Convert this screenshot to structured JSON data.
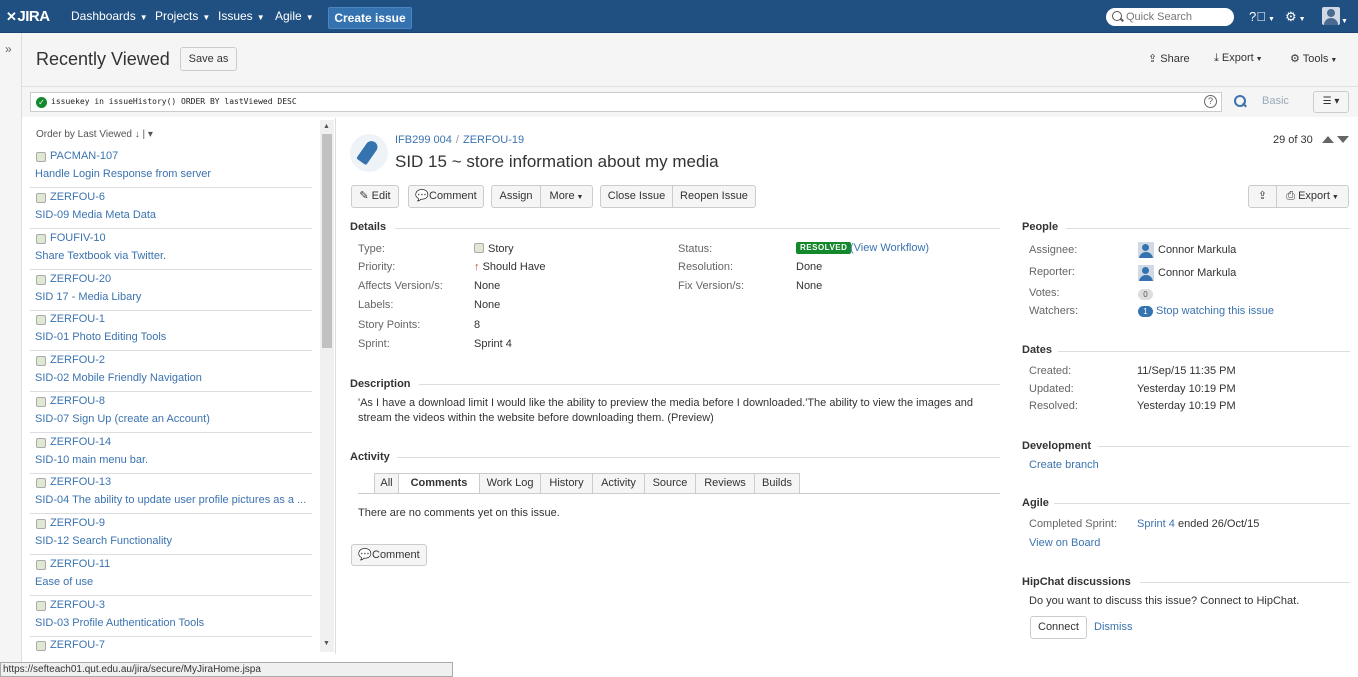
{
  "topbar": {
    "logo": "JIRA",
    "nav": [
      "Dashboards",
      "Projects",
      "Issues",
      "Agile"
    ],
    "create": "Create issue",
    "quick_search_placeholder": "Quick Search"
  },
  "header": {
    "title": "Recently Viewed",
    "save_as": "Save as",
    "share": "Share",
    "export": "Export",
    "tools": "Tools"
  },
  "search": {
    "jql": "issuekey in issueHistory() ORDER BY lastViewed DESC",
    "basic": "Basic"
  },
  "list": {
    "order_by": "Order by Last Viewed",
    "items": [
      {
        "key": "PACMAN-107",
        "summary": "Handle Login Response from server"
      },
      {
        "key": "ZERFOU-6",
        "summary": "SID-09 Media Meta Data"
      },
      {
        "key": "FOUFIV-10",
        "summary": "Share Textbook via Twitter."
      },
      {
        "key": "ZERFOU-20",
        "summary": "SID 17 - Media Libary"
      },
      {
        "key": "ZERFOU-1",
        "summary": "SID-01 Photo Editing Tools"
      },
      {
        "key": "ZERFOU-2",
        "summary": "SID-02 Mobile Friendly Navigation"
      },
      {
        "key": "ZERFOU-8",
        "summary": "SID-07 Sign Up (create an Account)"
      },
      {
        "key": "ZERFOU-14",
        "summary": "SID-10 main menu bar."
      },
      {
        "key": "ZERFOU-13",
        "summary": "SID-04 The ability to update user profile pictures as a ..."
      },
      {
        "key": "ZERFOU-9",
        "summary": "SID-12 Search Functionality"
      },
      {
        "key": "ZERFOU-11",
        "summary": "Ease of use"
      },
      {
        "key": "ZERFOU-3",
        "summary": "SID-03 Profile Authentication Tools"
      },
      {
        "key": "ZERFOU-7",
        "summary": ""
      }
    ]
  },
  "issue": {
    "project": "IFB299 004",
    "key": "ZERFOU-19",
    "title": "SID 15 ~ store information about my media",
    "pager": "29 of 30",
    "toolbar": {
      "edit": "Edit",
      "comment": "Comment",
      "assign": "Assign",
      "more": "More",
      "close": "Close Issue",
      "reopen": "Reopen Issue",
      "export": "Export"
    },
    "details_heading": "Details",
    "details": {
      "type_label": "Type:",
      "type": "Story",
      "priority_label": "Priority:",
      "priority": "Should Have",
      "affects_label": "Affects Version/s:",
      "affects": "None",
      "labels_label": "Labels:",
      "labels": "None",
      "points_label": "Story Points:",
      "points": "8",
      "sprint_label": "Sprint:",
      "sprint": "Sprint 4",
      "status_label": "Status:",
      "status": "RESOLVED",
      "view_workflow": "View Workflow",
      "resolution_label": "Resolution:",
      "resolution": "Done",
      "fix_label": "Fix Version/s:",
      "fix": "None"
    },
    "description_heading": "Description",
    "description_line1": "'As I have a download limit I would like the ability to preview the media before I downloaded.'The ability to view the images and",
    "description_line2": "stream the videos within the website before downloading them. (Preview)",
    "activity_heading": "Activity",
    "tabs": [
      "All",
      "Comments",
      "Work Log",
      "History",
      "Activity",
      "Source",
      "Reviews",
      "Builds"
    ],
    "no_comments": "There are no comments yet on this issue.",
    "comment_button": "Comment"
  },
  "people": {
    "heading": "People",
    "assignee_label": "Assignee:",
    "assignee": "Connor Markula",
    "reporter_label": "Reporter:",
    "reporter": "Connor Markula",
    "votes_label": "Votes:",
    "votes": "0",
    "watchers_label": "Watchers:",
    "watchers": "1",
    "stop_watching": "Stop watching this issue"
  },
  "dates": {
    "heading": "Dates",
    "created_label": "Created:",
    "created": "11/Sep/15 11:35 PM",
    "updated_label": "Updated:",
    "updated": "Yesterday 10:19 PM",
    "resolved_label": "Resolved:",
    "resolved": "Yesterday 10:19 PM"
  },
  "development": {
    "heading": "Development",
    "create_branch": "Create branch"
  },
  "agile": {
    "heading": "Agile",
    "completed_label": "Completed Sprint:",
    "sprint_link": "Sprint 4",
    "ended": "ended 26/Oct/15",
    "view_board": "View on Board"
  },
  "hipchat": {
    "heading": "HipChat discussions",
    "text": "Do you want to discuss this issue? Connect to HipChat.",
    "connect": "Connect",
    "dismiss": "Dismiss"
  },
  "statusbar": "https://sefteach01.qut.edu.au/jira/secure/MyJiraHome.jspa"
}
